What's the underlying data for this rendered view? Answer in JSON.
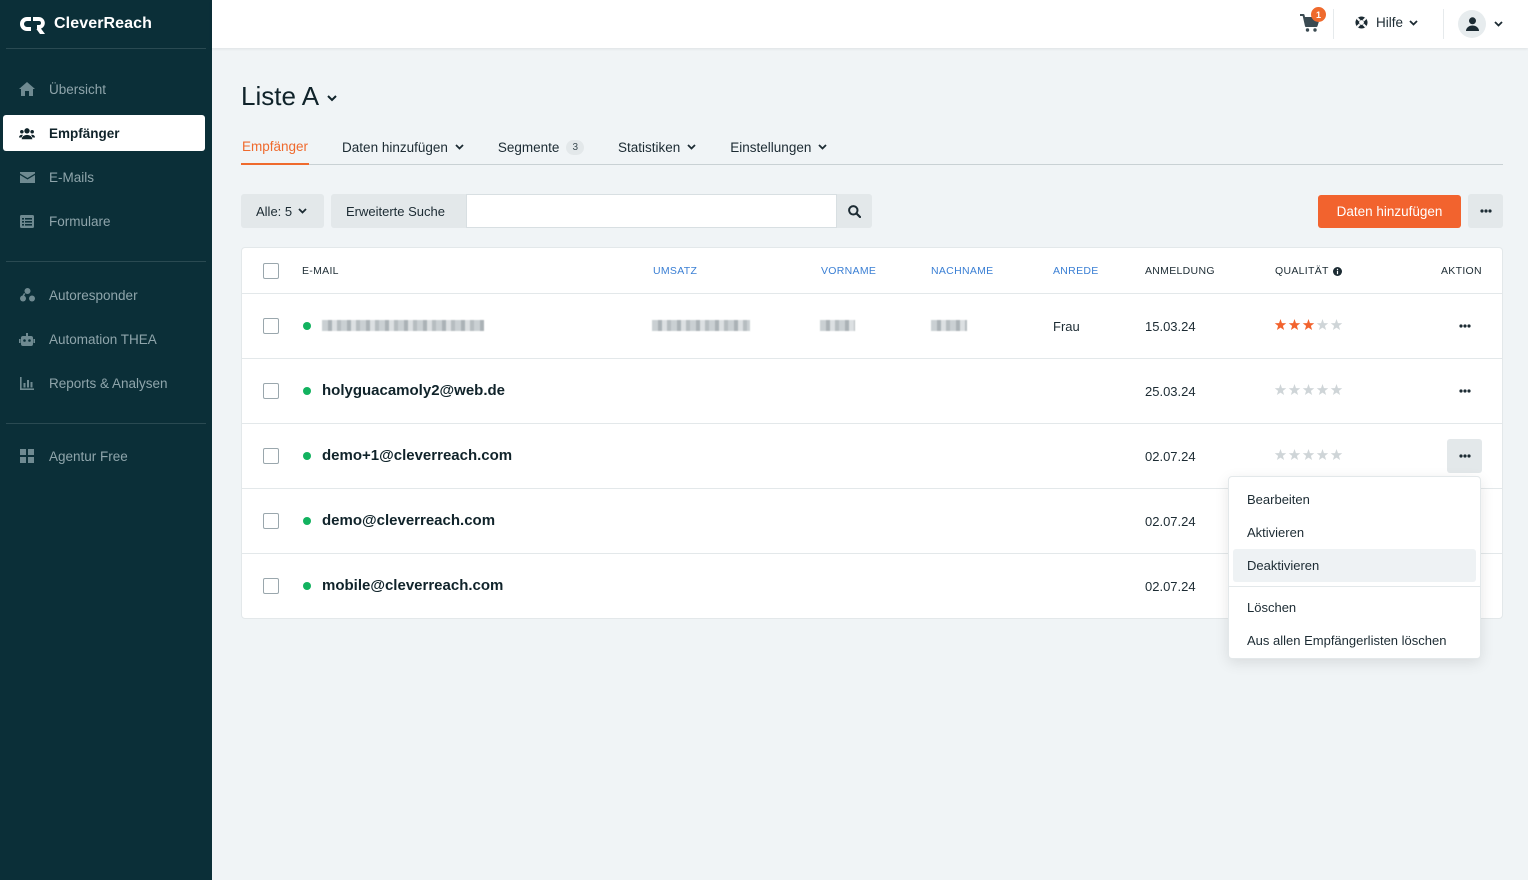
{
  "app": {
    "name": "CleverReach"
  },
  "sidebar": {
    "items": [
      {
        "label": "Übersicht",
        "icon": "home-icon"
      },
      {
        "label": "Empfänger",
        "icon": "users-icon",
        "active": true
      },
      {
        "label": "E-Mails",
        "icon": "envelope-icon"
      },
      {
        "label": "Formulare",
        "icon": "form-icon"
      },
      {
        "label": "Autoresponder",
        "icon": "autoresponder-icon"
      },
      {
        "label": "Automation THEA",
        "icon": "robot-icon"
      },
      {
        "label": "Reports & Analysen",
        "icon": "chart-icon"
      },
      {
        "label": "Agentur Free",
        "icon": "grid-icon"
      }
    ]
  },
  "topbar": {
    "cart_count": "1",
    "help_label": "Hilfe"
  },
  "page": {
    "title": "Liste A"
  },
  "tabs": [
    {
      "label": "Empfänger",
      "active": true
    },
    {
      "label": "Daten hinzufügen"
    },
    {
      "label": "Segmente",
      "count": "3"
    },
    {
      "label": "Statistiken"
    },
    {
      "label": "Einstellungen"
    }
  ],
  "toolbar": {
    "filter_label": "Alle: 5",
    "extended_search_label": "Erweiterte Suche",
    "search_value": "",
    "search_placeholder": "",
    "add_data_label": "Daten hinzufügen"
  },
  "table": {
    "columns": {
      "email": "E-MAIL",
      "umsatz": "UMSATZ",
      "vorname": "VORNAME",
      "nachname": "NACHNAME",
      "anrede": "ANREDE",
      "anmeldung": "ANMELDUNG",
      "qualitaet": "QUALITÄT",
      "aktion": "AKTION"
    },
    "rows": [
      {
        "email": "",
        "redacted": true,
        "anrede": "Frau",
        "anmeldung": "15.03.24",
        "quality": 3
      },
      {
        "email": "holyguacamoly2@web.de",
        "anrede": "",
        "anmeldung": "25.03.24",
        "quality": 0
      },
      {
        "email": "demo+1@cleverreach.com",
        "anrede": "",
        "anmeldung": "02.07.24",
        "quality": 0
      },
      {
        "email": "demo@cleverreach.com",
        "anrede": "",
        "anmeldung": "02.07.24",
        "quality": 0
      },
      {
        "email": "mobile@cleverreach.com",
        "anrede": "",
        "anmeldung": "02.07.24",
        "quality": 0
      }
    ]
  },
  "dropdown": {
    "items": [
      "Bearbeiten",
      "Aktivieren",
      "Deaktivieren"
    ],
    "items_after_divider": [
      "Löschen",
      "Aus allen Empfängerlisten löschen"
    ]
  },
  "colors": {
    "sidebar_bg": "#0b2f38",
    "accent": "#f2632e",
    "link": "#3a7fd4",
    "status_active": "#12b25f",
    "star_filled": "#f2632e",
    "star_empty": "#cfd5d8"
  }
}
